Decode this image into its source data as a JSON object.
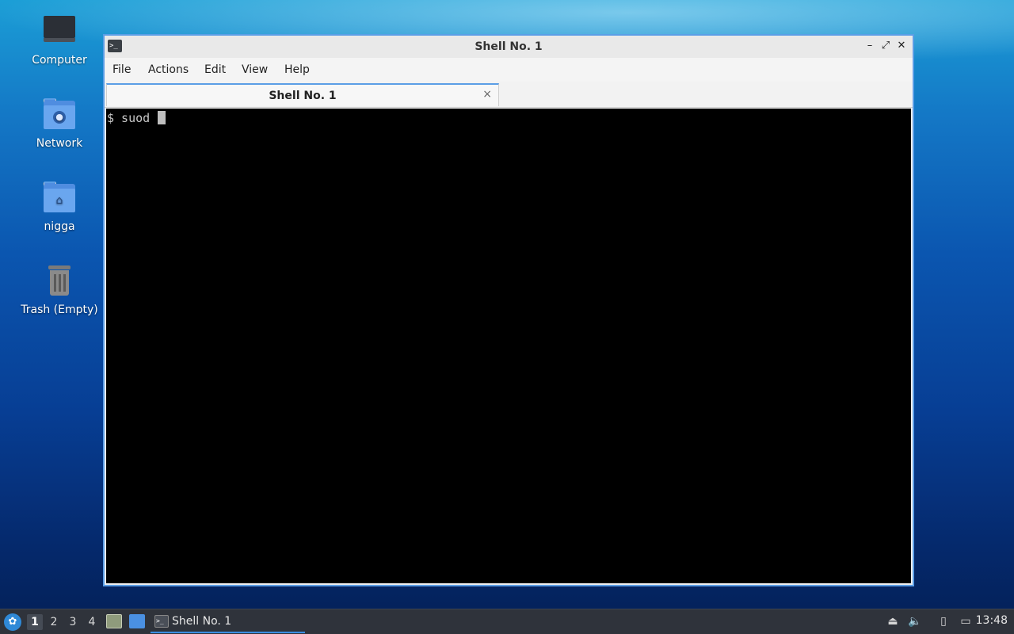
{
  "desktop": {
    "icons": [
      {
        "label": "Computer"
      },
      {
        "label": "Network"
      },
      {
        "label": "nigga"
      },
      {
        "label": "Trash (Empty)"
      }
    ]
  },
  "window": {
    "title": "Shell No. 1",
    "app_icon_text": ">_",
    "controls": {
      "minimize": "–",
      "maximize": "⤢",
      "close": "✕"
    },
    "menu": [
      "File",
      "Actions",
      "Edit",
      "View",
      "Help"
    ],
    "tab": {
      "label": "Shell No. 1",
      "close": "×"
    },
    "terminal": {
      "line": "$ suod "
    }
  },
  "taskbar": {
    "start_icon": "lubuntu-logo-icon",
    "workspaces": [
      "1",
      "2",
      "3",
      "4"
    ],
    "active_workspace": "1",
    "task": {
      "label": "Shell No. 1"
    },
    "clock": "13:48"
  },
  "colors": {
    "accent": "#5b9ee6",
    "taskbar_bg": "#2f333b",
    "terminal_bg": "#000000"
  }
}
